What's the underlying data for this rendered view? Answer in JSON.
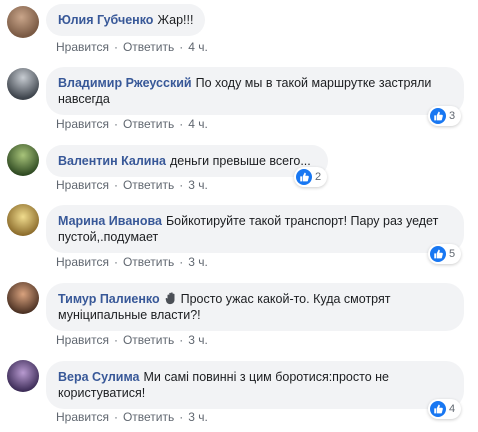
{
  "comments": [
    {
      "author": "Юлия Губченко",
      "text": "Жар!!!",
      "like_label": "Нравится",
      "reply_label": "Ответить",
      "time": "4 ч.",
      "reactions": "",
      "avatar_colors": [
        "#c9a58a",
        "#7a5a44"
      ]
    },
    {
      "author": "Владимир Ржеусский",
      "text": "По ходу мы в такой маршрутке застряли навсегда",
      "like_label": "Нравится",
      "reply_label": "Ответить",
      "time": "4 ч.",
      "reactions": "3",
      "avatar_colors": [
        "#9aa3ad",
        "#3e444c"
      ]
    },
    {
      "author": "Валентин Калина",
      "text": "деньги превыше всего...",
      "like_label": "Нравится",
      "reply_label": "Ответить",
      "time": "3 ч.",
      "reactions": "2",
      "avatar_colors": [
        "#6f9a4e",
        "#2f4a22"
      ]
    },
    {
      "author": "Марина Иванова",
      "text": "Бойкотируйте такой транспорт! Пару раз уедет пустой,.подумает",
      "like_label": "Нравится",
      "reply_label": "Ответить",
      "time": "3 ч.",
      "reactions": "5",
      "avatar_colors": [
        "#d9c27a",
        "#8a6a2a"
      ]
    },
    {
      "author": "Тимур Палиенко",
      "text": "Просто ужас какой-то. Куда смотрят муніципальные власти?!",
      "like_label": "Нравится",
      "reply_label": "Ответить",
      "time": "3 ч.",
      "reactions": "",
      "avatar_colors": [
        "#c48a64",
        "#4a3022"
      ]
    },
    {
      "author": "Вера Сулима",
      "text": "Ми самі повинні з цим боротися:просто не користуватися!",
      "like_label": "Нравится",
      "reply_label": "Ответить",
      "time": "3 ч.",
      "reactions": "4",
      "avatar_colors": [
        "#8a6aa8",
        "#3a2a55"
      ]
    }
  ],
  "colors": {
    "author": "#385898",
    "bubble": "#f2f3f5",
    "meta": "#606770",
    "like": "#1877f2"
  }
}
